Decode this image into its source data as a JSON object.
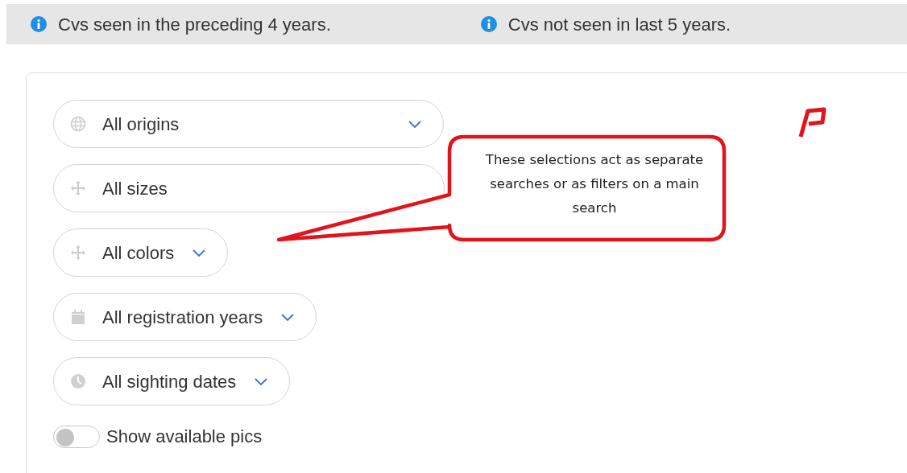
{
  "info_banner": [
    {
      "text": "Cvs seen in the preceding 4 years."
    },
    {
      "text": "Cvs not seen in last 5 years."
    }
  ],
  "filters": [
    {
      "kind": "origin",
      "label": "All origins",
      "chevron": true
    },
    {
      "kind": "size",
      "label": "All sizes",
      "chevron": false
    },
    {
      "kind": "color",
      "label": "All colors",
      "chevron": true
    },
    {
      "kind": "year",
      "label": "All registration years",
      "chevron": true
    },
    {
      "kind": "date",
      "label": "All sighting dates",
      "chevron": true
    }
  ],
  "toggle": {
    "label": "Show available pics",
    "on": false
  },
  "callout": {
    "text": "These selections act as separate searches or as filters on a main search"
  }
}
